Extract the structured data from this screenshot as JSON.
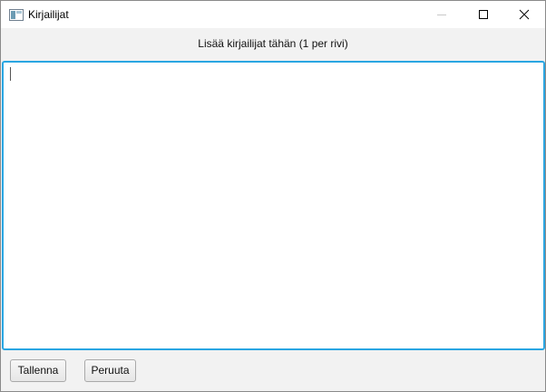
{
  "window": {
    "title": "Kirjailijat",
    "icon": "app-window-icon",
    "controls": {
      "minimize": "minimize-icon",
      "maximize": "maximize-icon",
      "close": "close-icon"
    }
  },
  "main": {
    "instruction_label": "Lisää kirjailijat tähän (1 per rivi)",
    "editor_value": "",
    "focus_color": "#2aa6e2"
  },
  "actions": {
    "save_label": "Tallenna",
    "cancel_label": "Peruuta"
  }
}
